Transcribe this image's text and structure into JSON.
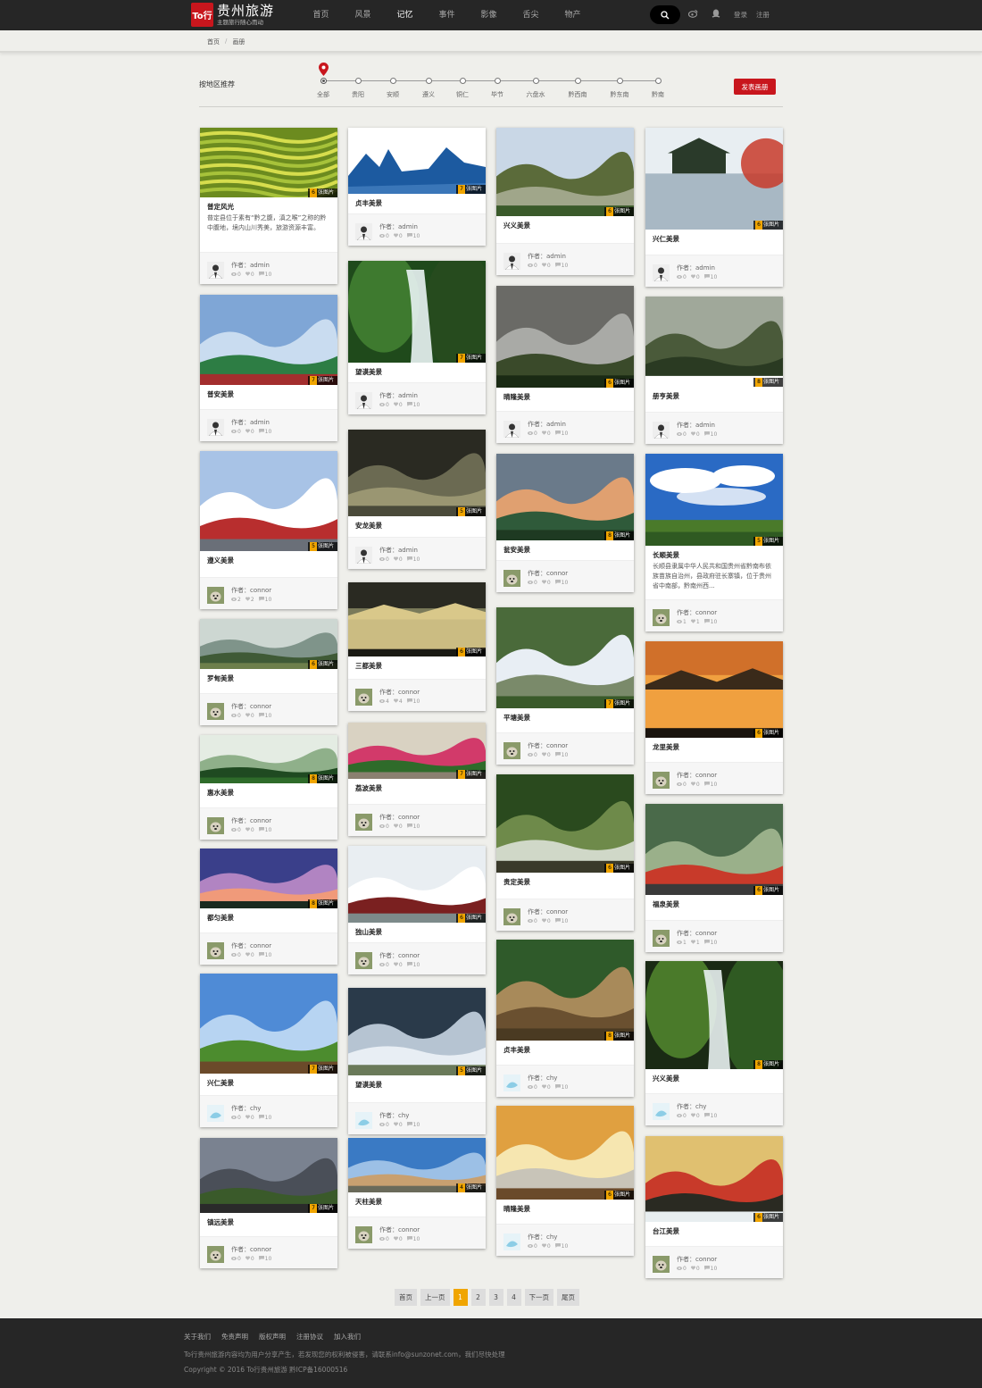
{
  "brand": {
    "mark": "To行",
    "title": "贵州旅游",
    "subtitle": "主题旅行随心而动"
  },
  "nav": [
    "首页",
    "风景",
    "记忆",
    "事件",
    "影像",
    "舌尖",
    "物产"
  ],
  "auth": {
    "login": "登录",
    "register": "注册"
  },
  "breadcrumb": [
    "首页",
    "画册"
  ],
  "filter": {
    "label": "按地区推荐",
    "regions": [
      "全部",
      "贵阳",
      "安顺",
      "遵义",
      "铜仁",
      "毕节",
      "六盘水",
      "黔西南",
      "黔东南",
      "黔南"
    ],
    "publish": "发表画册"
  },
  "author_prefix": "作者：",
  "photo_suffix": "张图片",
  "cards": [
    {
      "title": "普定风光",
      "desc": "普定县位于素有“黔之腹，滇之喉”之称的黔中腹地，境内山川秀美，旅游资源丰富。",
      "photos": "6",
      "author": "admin",
      "views": "0",
      "likes": "0",
      "comments": "10",
      "img": "terrace",
      "avatar": "man"
    },
    {
      "title": "普安美景",
      "desc": "",
      "photos": "7",
      "author": "admin",
      "views": "0",
      "likes": "0",
      "comments": "10",
      "img": "temple",
      "avatar": "man"
    },
    {
      "title": "遵义美景",
      "desc": "",
      "photos": "5",
      "author": "connor",
      "views": "2",
      "likes": "2",
      "comments": "10",
      "img": "building",
      "avatar": "dog"
    },
    {
      "title": "罗甸美景",
      "desc": "",
      "photos": "6",
      "author": "connor",
      "views": "0",
      "likes": "0",
      "comments": "10",
      "img": "valley",
      "avatar": "dog"
    },
    {
      "title": "惠水美景",
      "desc": "",
      "photos": "8",
      "author": "connor",
      "views": "0",
      "likes": "0",
      "comments": "10",
      "img": "forest",
      "avatar": "dog"
    },
    {
      "title": "都匀美景",
      "desc": "",
      "photos": "8",
      "author": "connor",
      "views": "0",
      "likes": "0",
      "comments": "10",
      "img": "dusk",
      "avatar": "dog"
    },
    {
      "title": "兴仁美景",
      "desc": "",
      "photos": "7",
      "author": "chy",
      "views": "0",
      "likes": "0",
      "comments": "10",
      "img": "folk",
      "avatar": "water"
    },
    {
      "title": "镇远美景",
      "desc": "",
      "photos": "7",
      "author": "connor",
      "views": "0",
      "likes": "0",
      "comments": "10",
      "img": "village",
      "avatar": "dog"
    },
    {
      "title": "贞丰美景",
      "desc": "",
      "photos": "7",
      "author": "admin",
      "views": "0",
      "likes": "0",
      "comments": "10",
      "img": "peaks",
      "avatar": "man"
    },
    {
      "title": "望谟美景",
      "desc": "",
      "photos": "7",
      "author": "admin",
      "views": "0",
      "likes": "0",
      "comments": "10",
      "img": "waterfall",
      "avatar": "man"
    },
    {
      "title": "安龙美景",
      "desc": "",
      "photos": "5",
      "author": "admin",
      "views": "0",
      "likes": "0",
      "comments": "10",
      "img": "cave",
      "avatar": "man"
    },
    {
      "title": "三都美景",
      "desc": "",
      "photos": "6",
      "author": "connor",
      "views": "4",
      "likes": "4",
      "comments": "10",
      "img": "sunset",
      "avatar": "dog"
    },
    {
      "title": "荔波美景",
      "desc": "",
      "photos": "7",
      "author": "connor",
      "views": "0",
      "likes": "0",
      "comments": "10",
      "img": "garden",
      "avatar": "dog"
    },
    {
      "title": "独山美景",
      "desc": "",
      "photos": "6",
      "author": "connor",
      "views": "0",
      "likes": "0",
      "comments": "10",
      "img": "snow",
      "avatar": "dog"
    },
    {
      "title": "望谟美景",
      "desc": "",
      "photos": "5",
      "author": "chy",
      "views": "0",
      "likes": "0",
      "comments": "10",
      "img": "mist",
      "avatar": "water"
    },
    {
      "title": "天柱美景",
      "desc": "",
      "photos": "4",
      "author": "connor",
      "views": "0",
      "likes": "0",
      "comments": "10",
      "img": "town",
      "avatar": "dog"
    },
    {
      "title": "兴义美景",
      "desc": "",
      "photos": "6",
      "author": "admin",
      "views": "0",
      "likes": "0",
      "comments": "10",
      "img": "karst",
      "avatar": "man"
    },
    {
      "title": "晴隆美景",
      "desc": "",
      "photos": "6",
      "author": "admin",
      "views": "0",
      "likes": "0",
      "comments": "10",
      "img": "fog",
      "avatar": "man"
    },
    {
      "title": "瓮安美景",
      "desc": "",
      "photos": "8",
      "author": "connor",
      "views": "0",
      "likes": "0",
      "comments": "10",
      "img": "bridge",
      "avatar": "dog"
    },
    {
      "title": "平塘美景",
      "desc": "",
      "photos": "7",
      "author": "connor",
      "views": "0",
      "likes": "0",
      "comments": "10",
      "img": "fast",
      "avatar": "dog"
    },
    {
      "title": "贵定美景",
      "desc": "",
      "photos": "6",
      "author": "connor",
      "views": "0",
      "likes": "0",
      "comments": "10",
      "img": "stream",
      "avatar": "dog"
    },
    {
      "title": "贞丰美景",
      "desc": "",
      "photos": "8",
      "author": "chy",
      "views": "0",
      "likes": "0",
      "comments": "10",
      "img": "walkway",
      "avatar": "water"
    },
    {
      "title": "晴隆美景",
      "desc": "",
      "photos": "6",
      "author": "chy",
      "views": "0",
      "likes": "0",
      "comments": "10",
      "img": "dance",
      "avatar": "water"
    },
    {
      "title": "兴仁美景",
      "desc": "",
      "photos": "6",
      "author": "admin",
      "views": "0",
      "likes": "0",
      "comments": "10",
      "img": "lake",
      "avatar": "man"
    },
    {
      "title": "册亨美景",
      "desc": "",
      "photos": "8",
      "author": "admin",
      "views": "0",
      "likes": "0",
      "comments": "10",
      "img": "hills",
      "avatar": "man"
    },
    {
      "title": "长顺美景",
      "desc": "长顺县隶属中华人民共和国贵州省黔南布依族苗族自治州，县政府驻长寨镇，位于贵州省中南部，黔南州西...",
      "photos": "5",
      "author": "connor",
      "views": "1",
      "likes": "1",
      "comments": "10",
      "img": "sky",
      "avatar": "dog"
    },
    {
      "title": "龙里美景",
      "desc": "",
      "photos": "6",
      "author": "connor",
      "views": "0",
      "likes": "0",
      "comments": "10",
      "img": "goldlake",
      "avatar": "dog"
    },
    {
      "title": "福泉美景",
      "desc": "",
      "photos": "6",
      "author": "connor",
      "views": "1",
      "likes": "1",
      "comments": "10",
      "img": "statue",
      "avatar": "dog"
    },
    {
      "title": "兴义美景",
      "desc": "",
      "photos": "8",
      "author": "chy",
      "views": "0",
      "likes": "0",
      "comments": "10",
      "img": "falls2",
      "avatar": "water"
    },
    {
      "title": "台江美景",
      "desc": "",
      "photos": "6",
      "author": "connor",
      "views": "0",
      "likes": "0",
      "comments": "10",
      "img": "boat",
      "avatar": "dog"
    }
  ],
  "pagination": [
    "首页",
    "上一页",
    "1",
    "2",
    "3",
    "4",
    "下一页",
    "尾页"
  ],
  "footer": {
    "links": [
      "关于我们",
      "免责声明",
      "版权声明",
      "注册协议",
      "加入我们"
    ],
    "note": "To行贵州旅游内容均为用户分享产生，若发现您的权利被侵害，请联系info@sunzonet.com，我们尽快处理",
    "copyright": "Copyright © 2016 To行贵州旅游 黔ICP备16000516"
  },
  "colors": {
    "brand_red": "#c8161d",
    "badge_orange": "#f0a500",
    "topbar": "#262626"
  }
}
